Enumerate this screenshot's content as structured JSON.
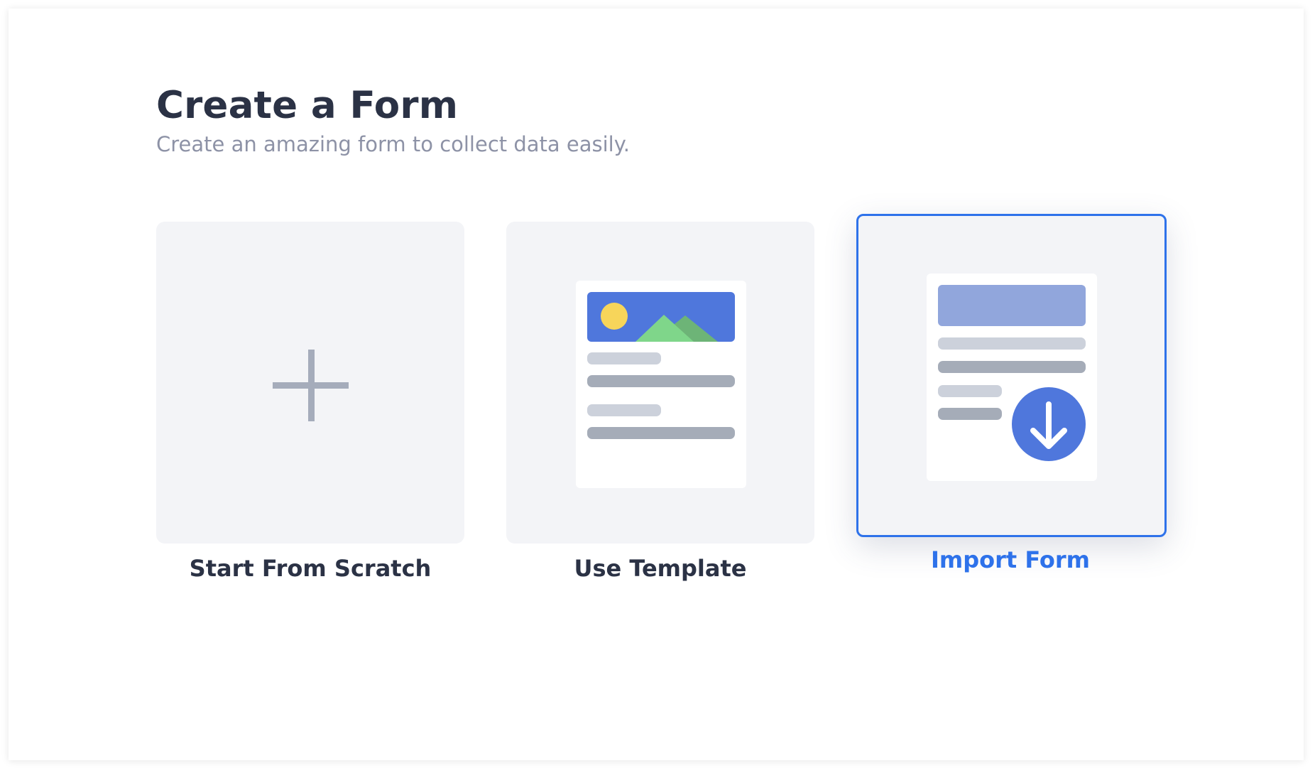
{
  "page": {
    "title": "Create a Form",
    "subtitle": "Create an amazing form to collect data easily."
  },
  "options": [
    {
      "label": "Start From Scratch",
      "icon": "plus-icon",
      "selected": false
    },
    {
      "label": "Use Template",
      "icon": "template-illustration-icon",
      "selected": false
    },
    {
      "label": "Import Form",
      "icon": "import-form-illustration-icon",
      "selected": true
    }
  ],
  "colors": {
    "title": "#2b3245",
    "subtitle": "#8d92a6",
    "card_background": "#f3f4f7",
    "accent": "#2e72ea",
    "illustration_blue": "#4f77dc",
    "illustration_header_light": "#91a6dc",
    "sun": "#f7d55a",
    "mountain_front": "#7fd68a",
    "mountain_back": "#6db477",
    "bar_light": "#ccd1db",
    "bar_dark": "#a5acb8",
    "plus": "#a5acbb"
  }
}
